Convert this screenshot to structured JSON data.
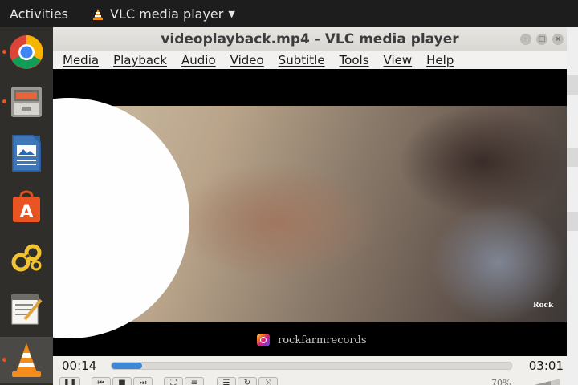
{
  "topbar": {
    "activities": "Activities",
    "app_name": "VLC media player"
  },
  "dock": {
    "items": [
      "chrome-icon",
      "file-manager-icon",
      "writer-icon",
      "software-center-icon",
      "settings-icon",
      "text-editor-icon",
      "vlc-icon"
    ]
  },
  "window": {
    "title": "videoplayback.mp4 - VLC media player"
  },
  "menu": [
    "Media",
    "Playback",
    "Audio",
    "Video",
    "Subtitle",
    "Tools",
    "View",
    "Help"
  ],
  "video": {
    "watermark": "rockfarmrecords",
    "logo_text": "Rock"
  },
  "player": {
    "current_time": "00:14",
    "total_time": "03:01",
    "progress": 0.077,
    "volume_label": "70%"
  },
  "colors": {
    "accent": "#3d87d6",
    "ubuntu_orange": "#e95420"
  }
}
